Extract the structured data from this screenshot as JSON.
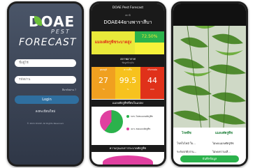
{
  "login": {
    "logo_main": "DOAE",
    "logo_pest": "PEST",
    "logo_forecast": "FORECAST",
    "username_placeholder": "ชื่อผู้ใช้",
    "password_placeholder": "รหัสผ่าน",
    "forgot_password": "ลืมรหัสผ่าน ?",
    "login_button": "Login",
    "register_link": "ลงทะเบียนใหม่",
    "copyright": "© 2021 DOAE. All Rights Reserved."
  },
  "dashboard": {
    "header_title": "DOAE Pest Forecast",
    "station_small": "สถานี",
    "station_name": "DOAE44ยางพาราสีบา",
    "risk_text": "แมลงศัตรูพืชระบาดสูง",
    "risk_percent": "72.50%",
    "condition_title": "สภาพอากาศ",
    "condition_sub": "ข้อมูลปัจจุบัน",
    "metrics": [
      {
        "label": "อุณหภูมิ",
        "value": "27",
        "unit": "°C",
        "color": "#f0a020"
      },
      {
        "label": "ความชื้น",
        "value": "99.5",
        "unit": "%",
        "color": "#f7c21e"
      },
      {
        "label": "ปริมาณฝน",
        "value": "44",
        "unit": "mm",
        "color": "#e0311a"
      }
    ],
    "insect_title": "แมลงศัตรูพืชที่พบในแปลง",
    "legend": [
      "59% ไม่พบแมลงศัตรูพืช",
      "41% พบแมลงศัตรูพืช"
    ],
    "severity_title": "ความรุนแรงการระบาดศัตรูพืช"
  },
  "photo_screen": {
    "col1_title": "โรคพืช",
    "col2_title": "แมลงศัตรูพืช",
    "col1_value": "โรคใบไหม้ ใบ...",
    "col1_value2": "ระดับปกติ/ปาน...",
    "col2_value": "ไม่พบแมลงศัตรูพืช",
    "col2_value2": "ไม่พบความเสี...",
    "button": "บันทึกข้อมูล"
  }
}
